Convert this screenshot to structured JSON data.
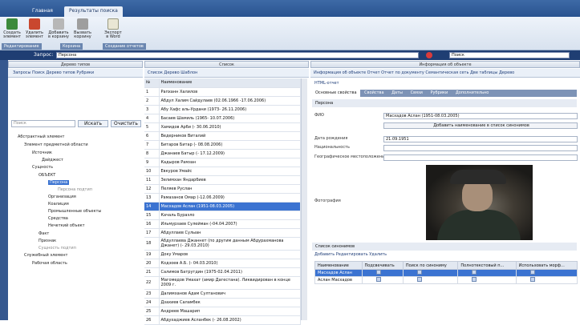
{
  "tabs": [
    "Главная",
    "Результаты поиска"
  ],
  "ribbon": {
    "buttons": [
      {
        "label": "Создать элемент",
        "icon": "create-icon"
      },
      {
        "label": "Удалить элемент",
        "icon": "delete-icon"
      },
      {
        "label": "Добавить в корзину",
        "icon": "basket-add-icon"
      },
      {
        "label": "Вызвать корзину",
        "icon": "basket-open-icon"
      },
      {
        "label": "Экспорт в Word",
        "icon": "word-export-icon"
      }
    ],
    "groups": [
      "Редактирование",
      "Корзина",
      "Создание отчетов"
    ]
  },
  "query": {
    "label": "Запрос:",
    "value": "Персона",
    "search_label": "Поиск"
  },
  "left": {
    "header": "Дерево типов",
    "toolbar": "Запросы  Поиск  Дерево типов  Рубрики",
    "search_placeholder": "Поиск",
    "find_btn": "Искать",
    "clear_btn": "Очистить",
    "tree": [
      "Абстрактный элемент",
      "Элемент предметной области",
      "Источник",
      "Дайджест",
      "Сущность",
      "ОБЪЕКТ",
      "Персона",
      "Персона подтип",
      "Организация",
      "Коалиция",
      "Промышленные объекты",
      "Средства",
      "Нечеткий объект",
      "Факт",
      "Признак",
      "Сущность подтип",
      "Служебный элемент",
      "Рабочая область"
    ]
  },
  "list": {
    "header": "Список",
    "toolbar": "Список  Дерево  Шаблон",
    "col_num": "№",
    "col_name": "Наименование",
    "rows": [
      {
        "n": "1",
        "name": "Рапханн Халилов"
      },
      {
        "n": "2",
        "name": "Абдул Халим Сайдулаев (02.06.1966 -17.06.2006)"
      },
      {
        "n": "3",
        "name": "Абу Хафс аль-Урдани (1973- 26.11.2006)"
      },
      {
        "n": "4",
        "name": "Басаев Шамиль (1965- 10.07.2006)"
      },
      {
        "n": "5",
        "name": "Хамидов Арби (- 30.06.2010)"
      },
      {
        "n": "6",
        "name": "Ведерников Виталий"
      },
      {
        "n": "7",
        "name": "Битаров Битар (- 08.08.2006)"
      },
      {
        "n": "8",
        "name": "Джанаев Батыр (- 17.12.2009)"
      },
      {
        "n": "9",
        "name": "Кадыров Рамзан"
      },
      {
        "n": "10",
        "name": "Евкуров Умайс"
      },
      {
        "n": "11",
        "name": "Зелимхан Яндарбиев"
      },
      {
        "n": "12",
        "name": "Пеляев Руслан"
      },
      {
        "n": "13",
        "name": "Рамазанов Омар (-12.06.2009)"
      },
      {
        "n": "14",
        "name": "Масхадов Аслан (1951-08.03.2005)"
      },
      {
        "n": "15",
        "name": "Качаль Бураэло"
      },
      {
        "n": "16",
        "name": "Ильмурзаев Сулейман (-04.04.2007)"
      },
      {
        "n": "17",
        "name": "Абдуллаев Сулыан"
      },
      {
        "n": "18",
        "name": "Абдуллаева Джаннет (по другим данным Абдурахманова Джанет) (- 29.03.2010)"
      },
      {
        "n": "19",
        "name": "Доку Умаров"
      },
      {
        "n": "20",
        "name": "Кодзоев А.Б. (- 04.03.2010)"
      },
      {
        "n": "21",
        "name": "Салимов Батрутдин (1975-02.04.2011)"
      },
      {
        "n": "22",
        "name": "Магомедов Умахат (амир Дагестана). Ликвидирован в конце 2009 г."
      },
      {
        "n": "23",
        "name": "Далимханов Адам Султанович"
      },
      {
        "n": "24",
        "name": "Дзахиев Саламбек"
      },
      {
        "n": "25",
        "name": "Андреев Машарип"
      },
      {
        "n": "26",
        "name": "Абдухаджиев Асланбек (- 26.08.2002)"
      }
    ],
    "selected_index": 13
  },
  "right": {
    "header": "Информация об объекте",
    "toolbar": "Информация об объекте  Отчет  Отчет по документу  Семантическая сеть  Две таблицы  Дерево",
    "html_report": "HTML-отчет",
    "subtabs": [
      "Основные свойства",
      "Свойства",
      "Даты",
      "Связи",
      "Рубрики",
      "Дополнительно"
    ],
    "section": "Персона",
    "fields": {
      "fio_label": "ФИО",
      "fio_value": "Масхадов Аслан (1951-08.03.2005)",
      "add_synonym_btn": "Добавить наименование в список синонимов",
      "birth_label": "Дата рождения",
      "birth_value": "21.09.1951",
      "nation_label": "Национальность",
      "geo_label": "Географическое местоположение",
      "photo_label": "Фотография"
    },
    "synonyms": {
      "title": "Список синонимов",
      "toolbar": "Добавить  Редактировать  Удалить",
      "cols": [
        "Наименование",
        "Подсвечивать",
        "Поиск по синониму",
        "Полнотекстовый п...",
        "Использовать морф..."
      ],
      "rows": [
        "Масхадов Аслан",
        "Аслан Масхадов"
      ]
    }
  }
}
